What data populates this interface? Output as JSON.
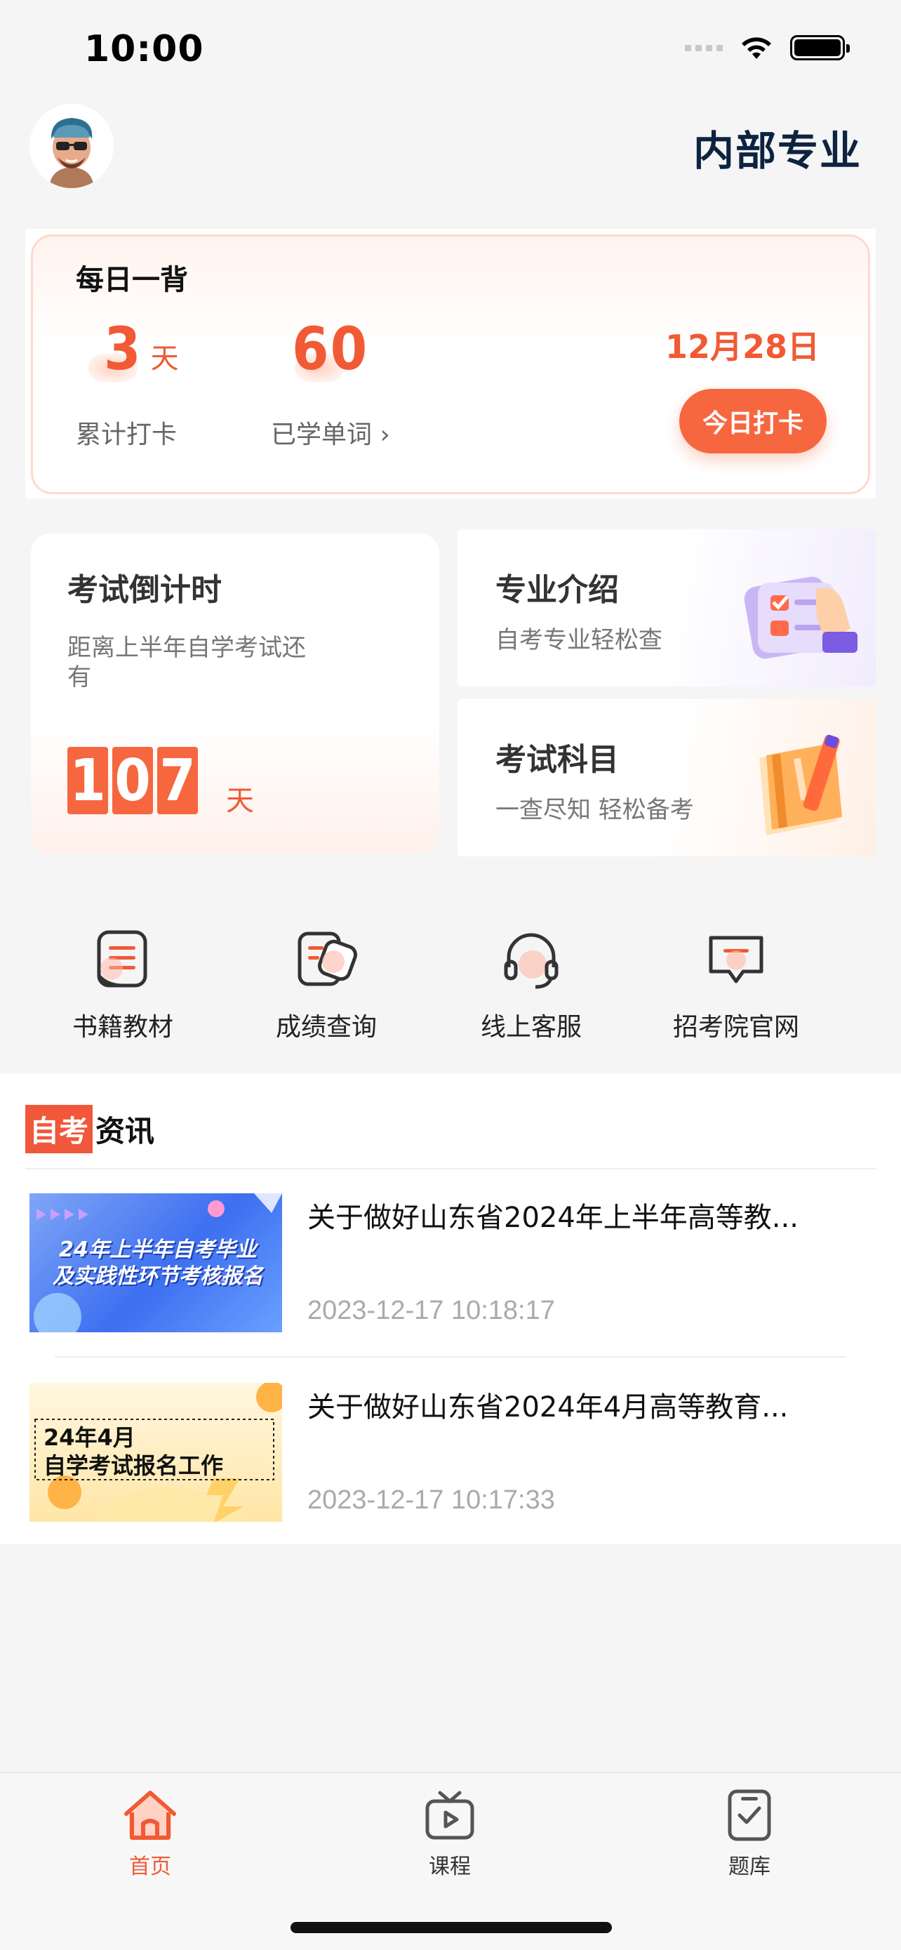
{
  "status_bar": {
    "time": "10:00"
  },
  "header": {
    "title": "内部专业"
  },
  "daily": {
    "title": "每日一背",
    "checkin_days": "3",
    "checkin_unit": "天",
    "checkin_label": "累计打卡",
    "words_count": "60",
    "words_label": "已学单词 ›",
    "date": "12月28日",
    "checkin_button": "今日打卡"
  },
  "countdown": {
    "title": "考试倒计时",
    "subtitle": "距离上半年自学考试还有",
    "digits": [
      "1",
      "0",
      "7"
    ],
    "unit": "天"
  },
  "cards": [
    {
      "title": "专业介绍",
      "subtitle": "自考专业轻松查"
    },
    {
      "title": "考试科目",
      "subtitle": "一查尽知 轻松备考"
    }
  ],
  "quick_links": [
    {
      "label": "书籍教材",
      "icon": "book-icon"
    },
    {
      "label": "成绩查询",
      "icon": "score-query-icon"
    },
    {
      "label": "线上客服",
      "icon": "headset-icon"
    },
    {
      "label": "招考院官网",
      "icon": "website-icon"
    }
  ],
  "news": {
    "heading_highlight": "自考",
    "heading_rest": "资讯",
    "items": [
      {
        "title": "关于做好山东省2024年上半年高等教...",
        "time": "2023-12-17 10:18:17",
        "thumb_text": [
          "24年上半年自考毕业",
          "及实践性环节考核报名"
        ]
      },
      {
        "title": "关于做好山东省2024年4月高等教育...",
        "time": "2023-12-17 10:17:33",
        "thumb_text": [
          "24年4月",
          "自学考试报名工作"
        ]
      }
    ]
  },
  "tabbar": {
    "tabs": [
      {
        "label": "首页",
        "active": true
      },
      {
        "label": "课程",
        "active": false
      },
      {
        "label": "题库",
        "active": false
      }
    ]
  },
  "colors": {
    "accent": "#f15a35",
    "title_dark": "#0d2440"
  }
}
